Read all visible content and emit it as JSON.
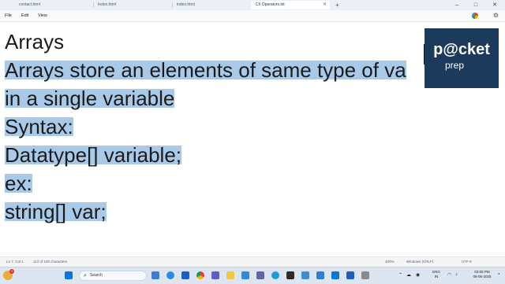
{
  "tabs": [
    {
      "label": "contact.html"
    },
    {
      "label": "Index.html"
    },
    {
      "label": "index.html"
    },
    {
      "label": "C# Operators.txt"
    }
  ],
  "window_controls": {
    "minimize": "–",
    "maximize": "□",
    "close": "✕",
    "new_tab": "+"
  },
  "menu": {
    "file": "File",
    "edit": "Edit",
    "view": "View"
  },
  "document": {
    "title": "Arrays",
    "line1": "Arrays store an elements of same type of va",
    "line2": "in a single variable",
    "line3": "Syntax:",
    "line4": "Datatype[] variable;",
    "line5": "ex:",
    "line6": "string[] var;"
  },
  "logo": {
    "line1": "p@cket",
    "line2": "prep"
  },
  "status": {
    "position": "Ln 7, Col 1",
    "chars": "113 of 126 characters",
    "zoom": "400%",
    "eol": "Windows (CRLF)",
    "encoding": "UTF-8"
  },
  "taskbar": {
    "search_label": "Search",
    "weather_badge": "3",
    "lang_line1": "ENG",
    "lang_line2": "IN",
    "time": "03:05 PM",
    "date": "06-06-2025"
  },
  "colors": {
    "selection": "#a9c9e8",
    "logo_bg": "#1b3a5c",
    "taskbar_bg": "#dde6f0"
  }
}
